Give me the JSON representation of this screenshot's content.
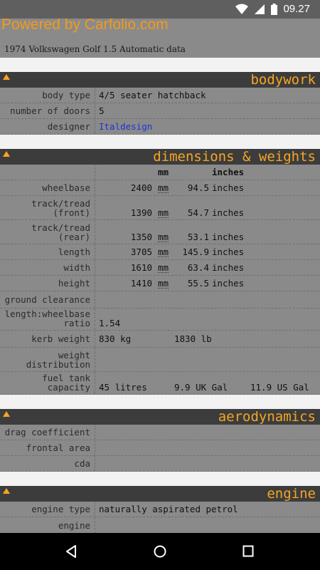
{
  "status": {
    "time": "09.27"
  },
  "header": {
    "powered_by": "Powered by Carfolio.com",
    "car_title": "1974 Volkswagen Golf 1.5 Automatic data"
  },
  "bodywork": {
    "title": "bodywork",
    "body_type_label": "body type",
    "body_type_value": "4/5 seater hatchback",
    "doors_label": "number of doors",
    "doors_value": "5",
    "designer_label": "designer",
    "designer_value": "Italdesign"
  },
  "dimensions": {
    "title": "dimensions & weights",
    "col_mm": "mm",
    "col_inches": "inches",
    "rows": [
      {
        "label1": "wheelbase",
        "label2": "",
        "mm": "2400",
        "mm_unit": "mm",
        "in": "94.5",
        "in_unit": "inches"
      },
      {
        "label1": "track/tread",
        "label2": "(front)",
        "mm": "1390",
        "mm_unit": "mm",
        "in": "54.7",
        "in_unit": "inches"
      },
      {
        "label1": "track/tread",
        "label2": "(rear)",
        "mm": "1350",
        "mm_unit": "mm",
        "in": "53.1",
        "in_unit": "inches"
      },
      {
        "label1": "length",
        "label2": "",
        "mm": "3705",
        "mm_unit": "mm",
        "in": "145.9",
        "in_unit": "inches"
      },
      {
        "label1": "width",
        "label2": "",
        "mm": "1610",
        "mm_unit": "mm",
        "in": "63.4",
        "in_unit": "inches"
      },
      {
        "label1": "height",
        "label2": "",
        "mm": "1410",
        "mm_unit": "mm",
        "in": "55.5",
        "in_unit": "inches"
      }
    ],
    "ground_label": "ground clearance",
    "ratio_label1": "length:wheelbase",
    "ratio_label2": "ratio",
    "ratio_value": "1.54",
    "kerb_label": "kerb weight",
    "kerb_kg": "830 kg",
    "kerb_lb": "1830 lb",
    "weight_dist_label1": "weight",
    "weight_dist_label2": "distribution",
    "fuel_label1": "fuel tank",
    "fuel_label2": "capacity",
    "fuel_litres": "45 litres",
    "fuel_uk": "9.9 UK Gal",
    "fuel_us": "11.9 US Gal"
  },
  "aerodynamics": {
    "title": "aerodynamics",
    "drag_label": "drag coefficient",
    "frontal_label": "frontal area",
    "cda_label": "cda"
  },
  "engine": {
    "title": "engine",
    "type_label": "engine type",
    "type_value": "naturally aspirated petrol",
    "next_label": "engine"
  },
  "colors": {
    "accent": "#f5a623",
    "section_bg": "#3c3c3c",
    "link": "#1f33d6"
  }
}
